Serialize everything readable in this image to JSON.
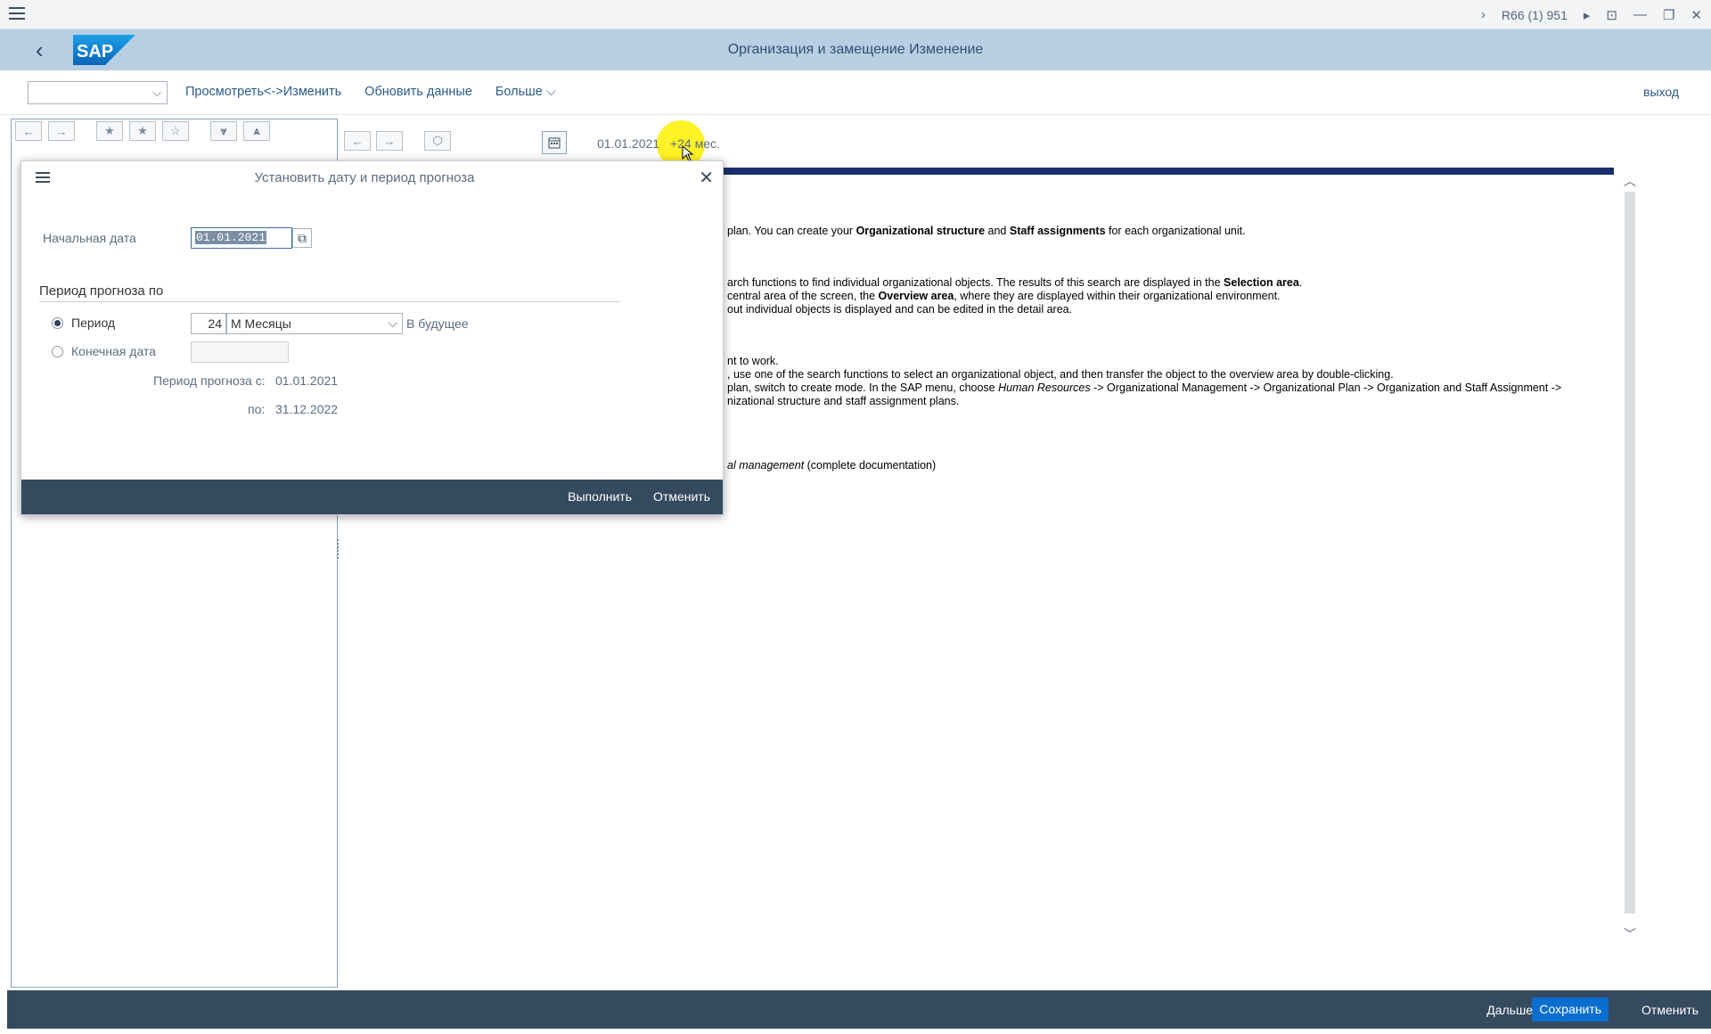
{
  "system_bar": {
    "system_id": "R66 (1) 951"
  },
  "shell": {
    "title": "Организация и замещение Изменение",
    "logo_text": "SAP"
  },
  "toolbar": {
    "dropdown_value": "",
    "view_edit": "Просмотреть<->Изменить",
    "refresh": "Обновить данные",
    "more": "Больше",
    "exit": "выход"
  },
  "right_toolbar": {
    "date": "01.01.2021",
    "period": "+24 мес."
  },
  "content": {
    "lines": [
      {
        "id": "l1",
        "parts": [
          {
            "t": "plan. You can create your "
          },
          {
            "t": "Organizational structure",
            "b": true
          },
          {
            "t": " and "
          },
          {
            "t": "Staff assignments",
            "b": true
          },
          {
            "t": " for each organizational unit."
          }
        ]
      },
      {
        "id": "l2",
        "parts": [
          {
            "t": "arch functions to find individual organizational objects. The results of this search are displayed in the "
          },
          {
            "t": "Selection area",
            "b": true
          },
          {
            "t": "."
          }
        ]
      },
      {
        "id": "l3",
        "parts": [
          {
            "t": " central area of the screen, the "
          },
          {
            "t": "Overview area",
            "b": true
          },
          {
            "t": ", where they are displayed within their organizational environment."
          }
        ]
      },
      {
        "id": "l4",
        "parts": [
          {
            "t": "out individual objects is displayed and can be edited in the detail area."
          }
        ]
      },
      {
        "id": "l5",
        "parts": [
          {
            "t": "nt to work."
          }
        ]
      },
      {
        "id": "l6",
        "parts": [
          {
            "t": ", use one of the search functions to select an organizational object, and then transfer the object to the overview area by double-clicking."
          }
        ]
      },
      {
        "id": "l7",
        "parts": [
          {
            "t": "plan, switch to create mode. In the SAP menu, choose "
          },
          {
            "t": "Human Resources",
            "i": true
          },
          {
            "t": " -> Organizational Management -> Organizational Plan -> Organization and Staff Assignment ->"
          }
        ]
      },
      {
        "id": "l8",
        "parts": [
          {
            "t": "nizational structure and staff assignment plans."
          }
        ]
      },
      {
        "id": "l9",
        "parts": [
          {
            "t": "al management",
            "i": true
          },
          {
            "t": " (complete documentation)"
          }
        ]
      }
    ]
  },
  "dialog": {
    "title": "Установить дату и период прогноза",
    "start_date_label": "Начальная дата",
    "start_date_value": "01.01.2021",
    "section_title": "Период прогноза по",
    "period_label": "Период",
    "period_value": "24",
    "period_unit": "М Месяцы",
    "future_label": "В будущее",
    "end_date_label": "Конечная дата",
    "end_date_value": "",
    "from_label": "Период прогноза с:",
    "from_value": "01.01.2021",
    "to_label": "по:",
    "to_value": "31.12.2022",
    "execute": "Выполнить",
    "cancel": "Отменить"
  },
  "footer": {
    "save": "Сохранить",
    "next": "Дальше",
    "cancel": "Отменить"
  }
}
